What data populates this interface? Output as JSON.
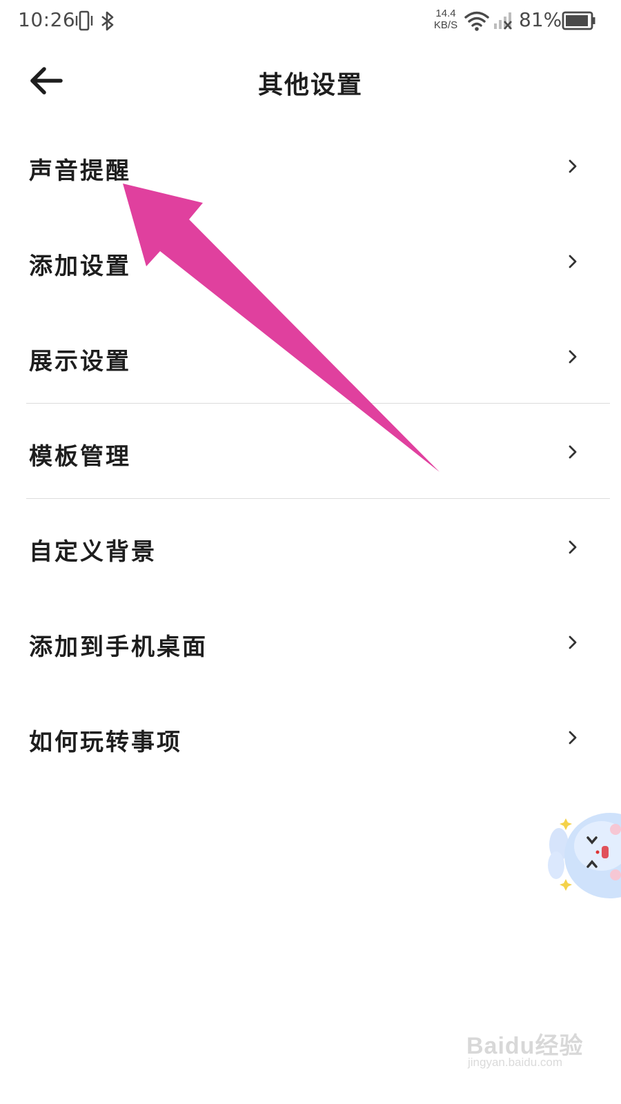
{
  "status_bar": {
    "time": "10:26",
    "net_speed_value": "14.4",
    "net_speed_unit": "KB/S",
    "battery_percent": "81%",
    "icons": [
      "vibrate-icon",
      "bluetooth-icon",
      "wifi-icon",
      "cell-signal-icon",
      "battery-icon"
    ]
  },
  "header": {
    "title": "其他设置",
    "back_icon": "arrow-left-icon"
  },
  "settings": {
    "items": [
      {
        "label": "声音提醒"
      },
      {
        "label": "添加设置"
      },
      {
        "label": "展示设置"
      },
      {
        "label": "模板管理"
      },
      {
        "label": "自定义背景"
      },
      {
        "label": "添加到手机桌面"
      },
      {
        "label": "如何玩转事项"
      }
    ],
    "chevron_icon": "chevron-right-icon"
  },
  "annotation": {
    "color": "#e0409e"
  },
  "watermark": {
    "brand": "Baidu经验",
    "url": "jingyan.baidu.com"
  }
}
